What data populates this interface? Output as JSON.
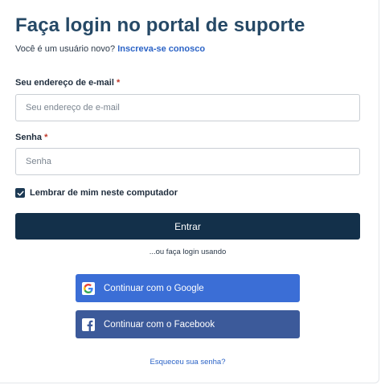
{
  "header": {
    "title": "Faça login no portal de suporte",
    "signup_prompt": "Você é um usuário novo?",
    "signup_link": "Inscreva-se conosco"
  },
  "form": {
    "email_label": "Seu endereço de e-mail",
    "email_required": "*",
    "email_placeholder": "Seu endereço de e-mail",
    "email_value": "",
    "password_label": "Senha",
    "password_required": "*",
    "password_placeholder": "Senha",
    "password_value": "",
    "remember_label": "Lembrar de mim neste computador",
    "remember_checked": true,
    "submit_label": "Entrar"
  },
  "alt_login": {
    "divider_text": "...ou faça login usando",
    "google_label": "Continuar com o Google",
    "google_icon": "google-g-icon",
    "facebook_label": "Continuar com o Facebook",
    "facebook_icon": "facebook-f-icon"
  },
  "footer": {
    "forgot_link": "Esqueceu sua senha?"
  },
  "colors": {
    "title": "#264966",
    "link": "#2b63c6",
    "primary_button": "#13304a",
    "google_button": "#3b6ed6",
    "facebook_button": "#3c5a9a",
    "required": "#c0392b"
  }
}
